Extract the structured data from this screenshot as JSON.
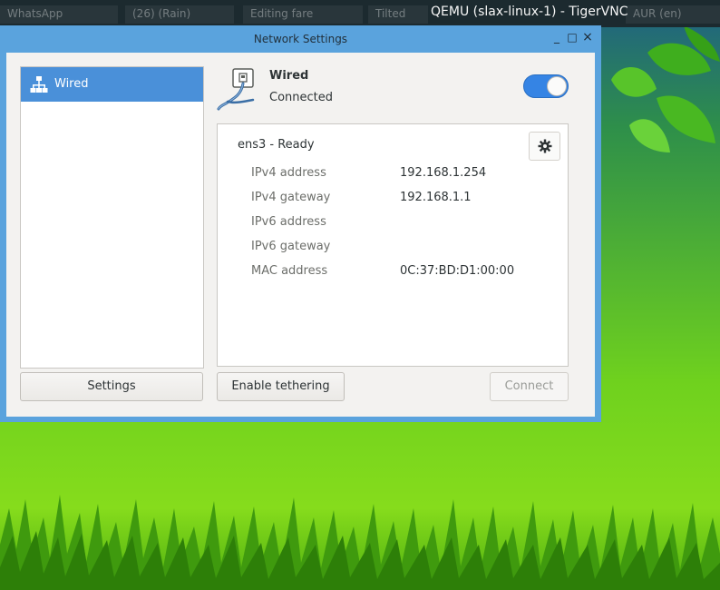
{
  "host": {
    "title": "QEMU (slax-linux-1) - TigerVNC",
    "background_tabs": [
      "WhatsApp",
      "(26) (Rain)",
      "Editing fare",
      "Tilted",
      "AUR (en)"
    ]
  },
  "window": {
    "title": "Network Settings",
    "controls": {
      "minimize": "_",
      "maximize": "□",
      "close": "×"
    }
  },
  "sidebar": {
    "items": [
      {
        "label": "Wired",
        "icon": "network-wired-icon",
        "selected": true
      }
    ],
    "settings_button": "Settings"
  },
  "header": {
    "title": "Wired",
    "status": "Connected",
    "toggle_on": true
  },
  "device": {
    "name": "ens3 - Ready",
    "rows": [
      {
        "label": "IPv4 address",
        "value": "192.168.1.254"
      },
      {
        "label": "IPv4 gateway",
        "value": "192.168.1.1"
      },
      {
        "label": "IPv6 address",
        "value": ""
      },
      {
        "label": "IPv6 gateway",
        "value": ""
      },
      {
        "label": "MAC address",
        "value": "0C:37:BD:D1:00:00"
      }
    ]
  },
  "buttons": {
    "tethering": "Enable tethering",
    "connect": "Connect"
  },
  "colors": {
    "accent": "#4a90d9",
    "titlebar": "#5aa3dd",
    "toggle": "#3584e4"
  }
}
